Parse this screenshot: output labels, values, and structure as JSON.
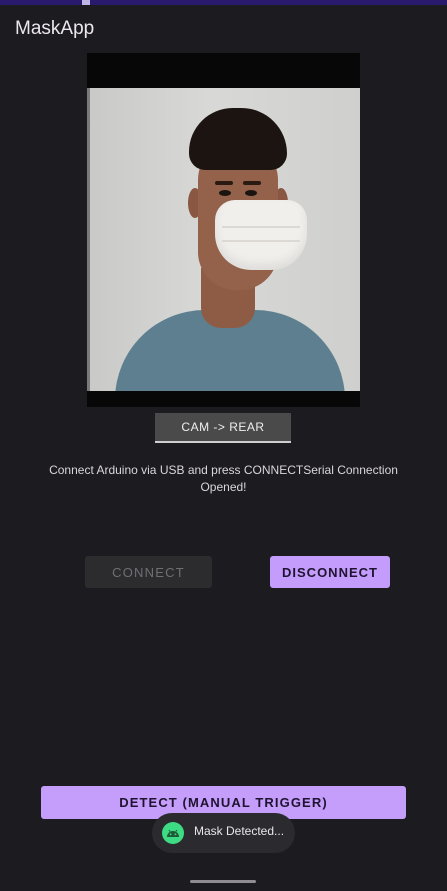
{
  "app": {
    "title": "MaskApp"
  },
  "camera": {
    "toggle_label": "CAM  ->  REAR"
  },
  "status": {
    "message": "Connect Arduino via USB and press CONNECTSerial Connection Opened!"
  },
  "buttons": {
    "connect_label": "CONNECT",
    "connect_enabled": false,
    "disconnect_label": "DISCONNECT",
    "detect_label": "DETECT (MANUAL TRIGGER)"
  },
  "toast": {
    "icon": "android-icon",
    "message": "Mask Detected..."
  },
  "colors": {
    "background": "#1c1b1f",
    "accent": "#c49cfb",
    "toast_icon": "#3ddc84",
    "status_bar": "#2a1a6e"
  }
}
